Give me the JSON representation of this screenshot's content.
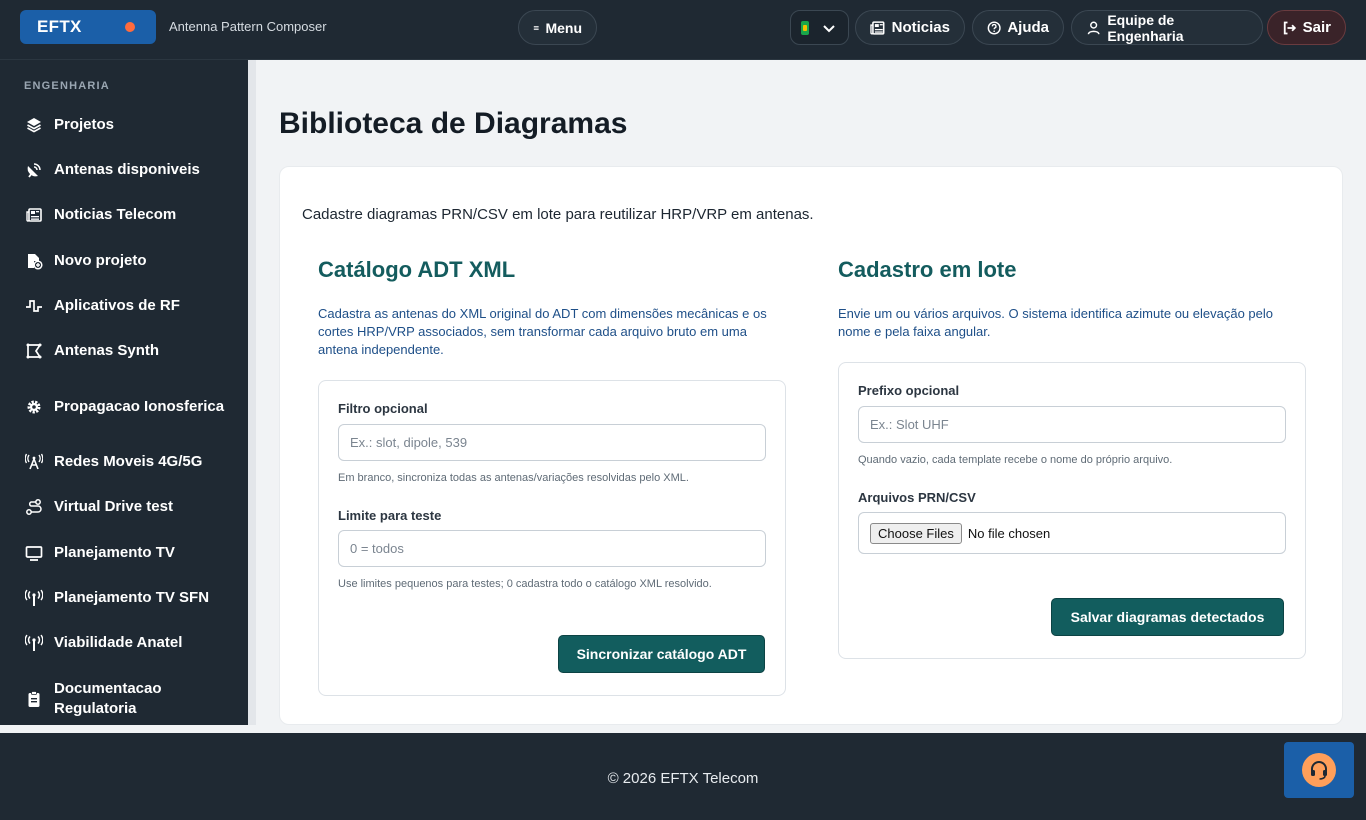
{
  "header": {
    "brand": "EFTX",
    "subtitle": "Antenna Pattern Composer",
    "menu_label": "Menu",
    "news_label": "Noticias",
    "help_label": "Ajuda",
    "team_label": "Equipe de Engenharia",
    "exit_label": "Sair"
  },
  "sidebar": {
    "section": "ENGENHARIA",
    "items": [
      {
        "label": "Projetos",
        "icon": "layers-icon"
      },
      {
        "label": "Antenas disponiveis",
        "icon": "satellite-dish-icon"
      },
      {
        "label": "Noticias Telecom",
        "icon": "newspaper-icon"
      },
      {
        "label": "Novo projeto",
        "icon": "new-file-icon"
      },
      {
        "label": "Aplicativos de RF",
        "icon": "pulse-wave-icon"
      },
      {
        "label": "Antenas Synth",
        "icon": "synth-frame-icon"
      },
      {
        "label": "Propagacao Ionosferica",
        "icon": "gear-icon"
      },
      {
        "label": "Redes Moveis 4G/5G",
        "icon": "cell-tower-icon"
      },
      {
        "label": "Virtual Drive test",
        "icon": "route-icon"
      },
      {
        "label": "Planejamento TV",
        "icon": "monitor-icon"
      },
      {
        "label": "Planejamento TV SFN",
        "icon": "broadcast-antenna-icon"
      },
      {
        "label": "Viabilidade Anatel",
        "icon": "broadcast-antenna-icon"
      },
      {
        "label": "Documentacao Regulatoria",
        "icon": "clipboard-icon"
      }
    ]
  },
  "main": {
    "title": "Biblioteca de Diagramas",
    "lead": "Cadastre diagramas PRN/CSV em lote para reutilizar HRP/VRP em antenas.",
    "adt": {
      "title": "Catálogo ADT XML",
      "description": "Cadastra as antenas do XML original do ADT com dimensões mecânicas e os cortes HRP/VRP associados, sem transformar cada arquivo bruto em uma antena independente.",
      "filter_label": "Filtro opcional",
      "filter_placeholder": "Ex.: slot, dipole, 539",
      "filter_hint": "Em branco, sincroniza todas as antenas/variações resolvidas pelo XML.",
      "limit_label": "Limite para teste",
      "limit_placeholder": "0 = todos",
      "limit_hint": "Use limites pequenos para testes; 0 cadastra todo o catálogo XML resolvido.",
      "button": "Sincronizar catálogo ADT"
    },
    "batch": {
      "title": "Cadastro em lote",
      "description": "Envie um ou vários arquivos. O sistema identifica azimute ou elevação pelo nome e pela faixa angular.",
      "prefix_label": "Prefixo opcional",
      "prefix_placeholder": "Ex.: Slot UHF",
      "prefix_hint": "Quando vazio, cada template recebe o nome do próprio arquivo.",
      "files_label": "Arquivos PRN/CSV",
      "choose_label": "Choose Files",
      "no_file": "No file chosen",
      "button": "Salvar diagramas detectados"
    }
  },
  "footer": {
    "text": "© 2026 EFTX Telecom"
  },
  "colors": {
    "dark": "#1f2933",
    "brand_blue": "#1b5fa8",
    "teal": "#125d5e",
    "accent_orange": "#ff9f5a"
  }
}
